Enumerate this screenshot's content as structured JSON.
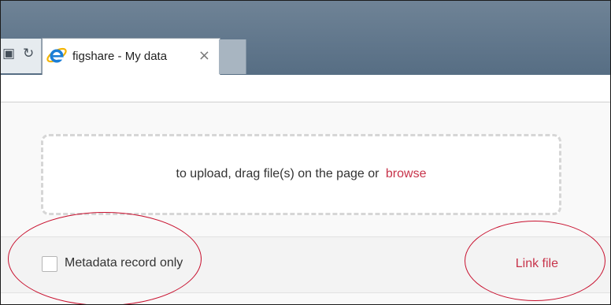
{
  "browser": {
    "tab_title": "figshare - My data",
    "tab_close": "×",
    "compat_icon": "compatibility-view-icon",
    "refresh_icon": "refresh-icon",
    "favicon": "internet-explorer-icon"
  },
  "upload": {
    "prompt": "to upload, drag file(s) on the page or",
    "browse_label": "browse"
  },
  "options": {
    "metadata_only_label": "Metadata record only",
    "metadata_only_checked": false,
    "link_file_label": "Link file"
  },
  "colors": {
    "accent": "#c7334a",
    "annotation": "#c8102e",
    "tab_strip": "#61778c"
  }
}
